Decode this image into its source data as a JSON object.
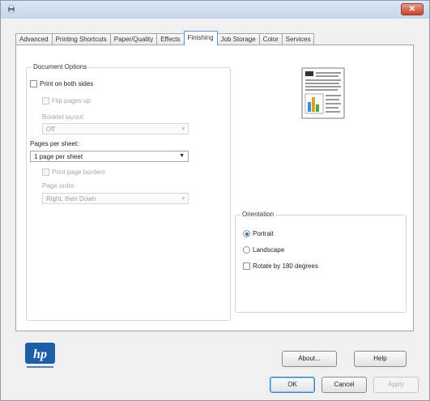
{
  "window": {
    "close_label": "✕"
  },
  "tabs": [
    {
      "label": "Advanced"
    },
    {
      "label": "Printing Shortcuts"
    },
    {
      "label": "Paper/Quality"
    },
    {
      "label": "Effects"
    },
    {
      "label": "Finishing",
      "active": true
    },
    {
      "label": "Job Storage"
    },
    {
      "label": "Color"
    },
    {
      "label": "Services"
    }
  ],
  "document_options": {
    "legend": "Document Options",
    "print_both_sides": "Print on both sides",
    "flip_pages_up": "Flip pages up",
    "booklet_layout_label": "Booklet layout:",
    "booklet_layout_value": "Off",
    "pages_per_sheet_label": "Pages per sheet:",
    "pages_per_sheet_value": "1 page per sheet",
    "print_page_borders": "Print page borders",
    "page_order_label": "Page order:",
    "page_order_value": "Right, then Down"
  },
  "orientation": {
    "legend": "Orientation",
    "portrait": "Portrait",
    "landscape": "Landscape",
    "rotate": "Rotate by 180 degrees",
    "selected": "portrait"
  },
  "buttons": {
    "about": "About...",
    "help": "Help",
    "ok": "OK",
    "cancel": "Cancel",
    "apply": "Apply"
  },
  "colors": {
    "accent": "#2f6fb8",
    "hp_blue": "#1c5fa8"
  }
}
